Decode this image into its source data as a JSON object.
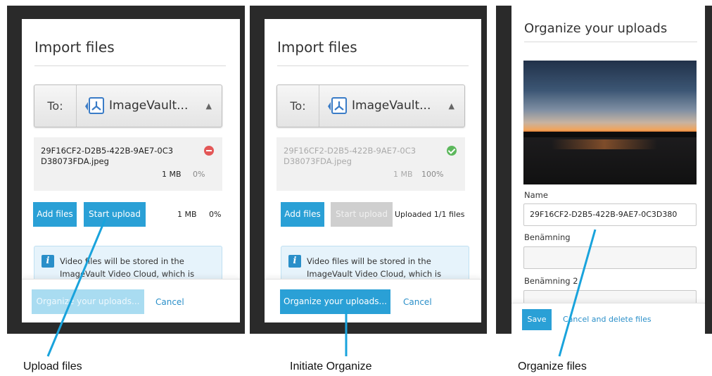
{
  "colors": {
    "primary": "#2aa0d6",
    "link": "#2a8fc9",
    "annotation": "#19a3dc"
  },
  "screens": {
    "upload": {
      "title": "Import files",
      "to_label": "To:",
      "destination": "ImageVault...",
      "destination_icon": "vault-logo-icon",
      "file": {
        "name": "29F16CF2-D2B5-422B-9AE7-0C3D38073FDA.jpeg",
        "size": "1 MB",
        "progress": "0%",
        "status_icon": "remove-icon"
      },
      "add_files": "Add files",
      "start_upload": "Start upload",
      "total_size": "1 MB",
      "total_progress": "0%",
      "notice_line1": "Video files will be stored in the",
      "notice_line2": "ImageVault Video Cloud, which is",
      "organize": "Organize your uploads...",
      "cancel": "Cancel"
    },
    "initiate": {
      "title": "Import files",
      "to_label": "To:",
      "destination": "ImageVault...",
      "destination_icon": "vault-logo-icon",
      "file": {
        "name": "29F16CF2-D2B5-422B-9AE7-0C3D38073FDA.jpeg",
        "size": "1 MB",
        "progress": "100%",
        "status_icon": "check-icon"
      },
      "add_files": "Add files",
      "start_upload": "Start upload",
      "upload_status": "Uploaded 1/1 files",
      "notice_line1": "Video files will be stored in the",
      "notice_line2": "ImageVault Video Cloud, which is",
      "organize": "Organize your uploads...",
      "cancel": "Cancel"
    },
    "organize": {
      "title": "Organize your uploads",
      "name_label": "Name",
      "name_value": "29F16CF2-D2B5-422B-9AE7-0C3D380",
      "field1_label": "Benämning",
      "field1_value": "",
      "field2_label": "Benämning 2",
      "field2_value": "",
      "save": "Save",
      "cancel_delete": "Cancel and delete files"
    }
  },
  "captions": {
    "upload": "Upload files",
    "initiate": "Initiate Organize",
    "organize": "Organize files"
  }
}
